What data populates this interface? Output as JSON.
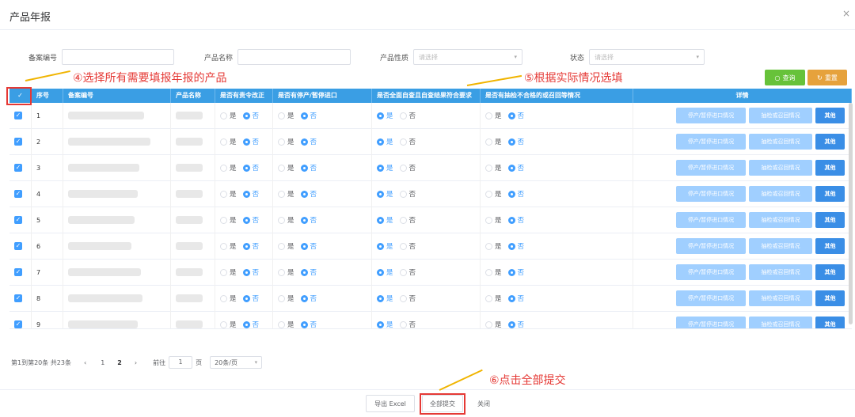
{
  "dialog": {
    "title": "产品年报",
    "close_icon": "×"
  },
  "filters": {
    "record_no_label": "备案编号",
    "product_name_label": "产品名称",
    "product_nature_label": "产品性质",
    "product_nature_placeholder": "请选择",
    "status_label": "状态",
    "status_placeholder": "请选择"
  },
  "buttons": {
    "query": "查询",
    "reset": "重置"
  },
  "annotations": {
    "step4": "④选择所有需要填报年报的产品",
    "step5": "⑤根据实际情况选填",
    "step6": "⑥点击全部提交"
  },
  "table": {
    "headers": [
      "✓",
      "序号",
      "备案编号",
      "产品名称",
      "是否有责令改正",
      "是否有停产/暂停进口",
      "是否全面自查且自查结果符合要求",
      "是否有抽检不合格的或召回等情况",
      "详情"
    ],
    "radio_yes": "是",
    "radio_no": "否",
    "action_1": "停产/暂停进口情况",
    "action_2": "抽检或召回情况",
    "action_3": "其他",
    "rows": [
      {
        "no": "1"
      },
      {
        "no": "2"
      },
      {
        "no": "3"
      },
      {
        "no": "4"
      },
      {
        "no": "5"
      },
      {
        "no": "6"
      },
      {
        "no": "7"
      },
      {
        "no": "8"
      },
      {
        "no": "9"
      }
    ]
  },
  "pager": {
    "summary": "第1到第20条 共23条",
    "prev": "‹",
    "next": "›",
    "page1": "1",
    "page2": "2",
    "goto_label": "前往",
    "goto_value": "1",
    "page_unit": "页",
    "page_size": "20条/页"
  },
  "footer": {
    "export": "导出 Excel",
    "submit_all": "全部提交",
    "close": "关闭"
  },
  "colors": {
    "header_blue": "#3a9ee4",
    "primary": "#409eff",
    "annotation_red": "#e53935",
    "arrow_yellow": "#f0b400"
  }
}
